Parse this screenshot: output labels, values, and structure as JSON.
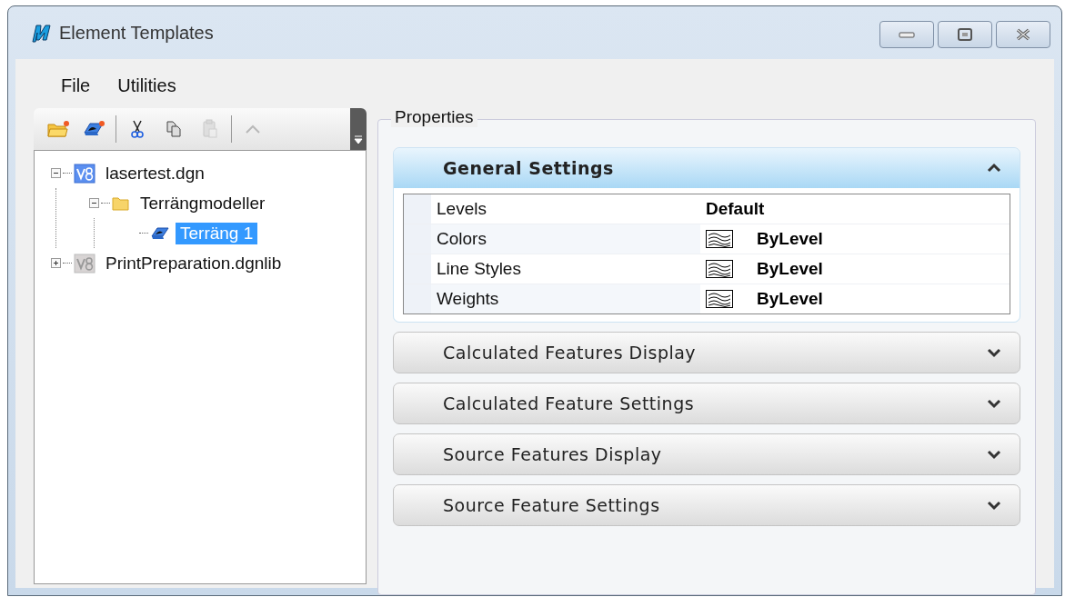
{
  "window": {
    "title": "Element Templates"
  },
  "menu": [
    "File",
    "Utilities"
  ],
  "toolbar": [
    {
      "kind": "folder",
      "disabled": false
    },
    {
      "kind": "terrain",
      "disabled": false
    },
    {
      "kind": "separator"
    },
    {
      "kind": "cut",
      "disabled": false
    },
    {
      "kind": "copy",
      "disabled": false
    },
    {
      "kind": "paste",
      "disabled": true
    },
    {
      "kind": "separator"
    },
    {
      "kind": "up",
      "disabled": true
    }
  ],
  "tree": [
    {
      "label": "lasertest.dgn",
      "kind": "dgn",
      "expanded": true,
      "selected": false,
      "children": [
        {
          "label": "Terrängmodeller",
          "kind": "folder",
          "expanded": true,
          "selected": false,
          "children": [
            {
              "label": "Terräng 1",
              "kind": "terrain",
              "selected": true
            }
          ]
        }
      ]
    },
    {
      "label": "PrintPreparation.dgnlib",
      "kind": "dgnlib",
      "expanded": false,
      "selected": false
    }
  ],
  "properties": {
    "title": "Properties",
    "sections": [
      {
        "title": "General Settings",
        "expanded": true,
        "rows": [
          {
            "name": "Levels",
            "value": "Default",
            "kind": "text"
          },
          {
            "name": "Colors",
            "value": "ByLevel",
            "kind": "bylevel"
          },
          {
            "name": "Line Styles",
            "value": "ByLevel",
            "kind": "bylevel"
          },
          {
            "name": "Weights",
            "value": "ByLevel",
            "kind": "bylevel"
          }
        ]
      },
      {
        "title": "Calculated Features Display",
        "expanded": false
      },
      {
        "title": "Calculated Feature Settings",
        "expanded": false
      },
      {
        "title": "Source Features Display",
        "expanded": false
      },
      {
        "title": "Source Feature Settings",
        "expanded": false
      }
    ]
  }
}
